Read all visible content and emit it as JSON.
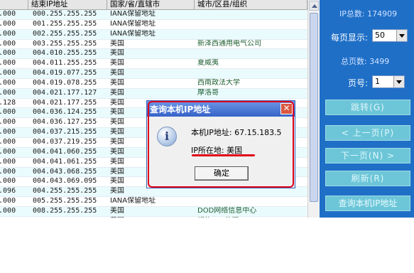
{
  "table": {
    "headers": [
      "",
      "结束IP地址",
      "国家/省/直辖市",
      "城市/区县/组织"
    ],
    "rows": [
      [
        "0.000",
        "000.255.255.255",
        "IANA保留地址",
        ""
      ],
      [
        "0.000",
        "001.255.255.255",
        "IANA保留地址",
        ""
      ],
      [
        "0.000",
        "002.255.255.255",
        "IANA保留地址",
        ""
      ],
      [
        "0.000",
        "003.255.255.255",
        "美国",
        "新泽西通用电气公司"
      ],
      [
        "0.000",
        "004.010.255.255",
        "美国",
        ""
      ],
      [
        "0.000",
        "004.011.255.255",
        "美国",
        "夏威夷"
      ],
      [
        "0.000",
        "004.019.077.255",
        "美国",
        ""
      ],
      [
        "0.000",
        "004.019.078.255",
        "美国",
        "西南政法大学"
      ],
      [
        "9.000",
        "004.021.177.127",
        "美国",
        "摩洛哥"
      ],
      [
        "7.128",
        "004.021.177.255",
        "美国",
        ""
      ],
      [
        "0.000",
        "004.036.124.255",
        "美国",
        ""
      ],
      [
        "5.000",
        "004.036.127.255",
        "美国",
        ""
      ],
      [
        "8.000",
        "004.037.215.255",
        "美国",
        ""
      ],
      [
        "5.000",
        "004.037.219.255",
        "美国",
        ""
      ],
      [
        "0.000",
        "004.041.060.255",
        "美国",
        ""
      ],
      [
        "1.000",
        "004.041.061.255",
        "美国",
        ""
      ],
      [
        "2.000",
        "004.043.068.255",
        "美国",
        ""
      ],
      [
        "0.000",
        "004.043.069.095",
        "美国",
        ""
      ],
      [
        "9.096",
        "004.255.255.255",
        "美国",
        ""
      ],
      [
        "0.000",
        "005.255.255.255",
        "IANA保留地址",
        ""
      ],
      [
        "0.000",
        "008.255.255.255",
        "美国",
        "DOD网络信息中心"
      ],
      [
        "0.000",
        "009.255.255.255",
        "美国",
        "纽约IBM公司"
      ],
      [
        "0.000",
        "010.255.255.255",
        "局域网",
        ""
      ]
    ]
  },
  "side": {
    "total_ips": "IP总数: 174909",
    "per_page_label": "每页显示:",
    "per_page_value": "50",
    "total_pages": "总页数: 3499",
    "page_no_label": "页号:",
    "page_no_value": "1",
    "btn_jump": "跳转(G)",
    "btn_prev": "< 上一页(P)",
    "btn_next": "下一页(N) >",
    "btn_refresh": "刷新(R)",
    "btn_query_ip": "查询本机IP地址"
  },
  "dialog": {
    "title": "查询本机IP地址",
    "close": "✕",
    "icon": "i",
    "ip_line": "本机IP地址: 67.15.183.5",
    "location_line": "IP所在地: 美国",
    "ok": "确定"
  }
}
